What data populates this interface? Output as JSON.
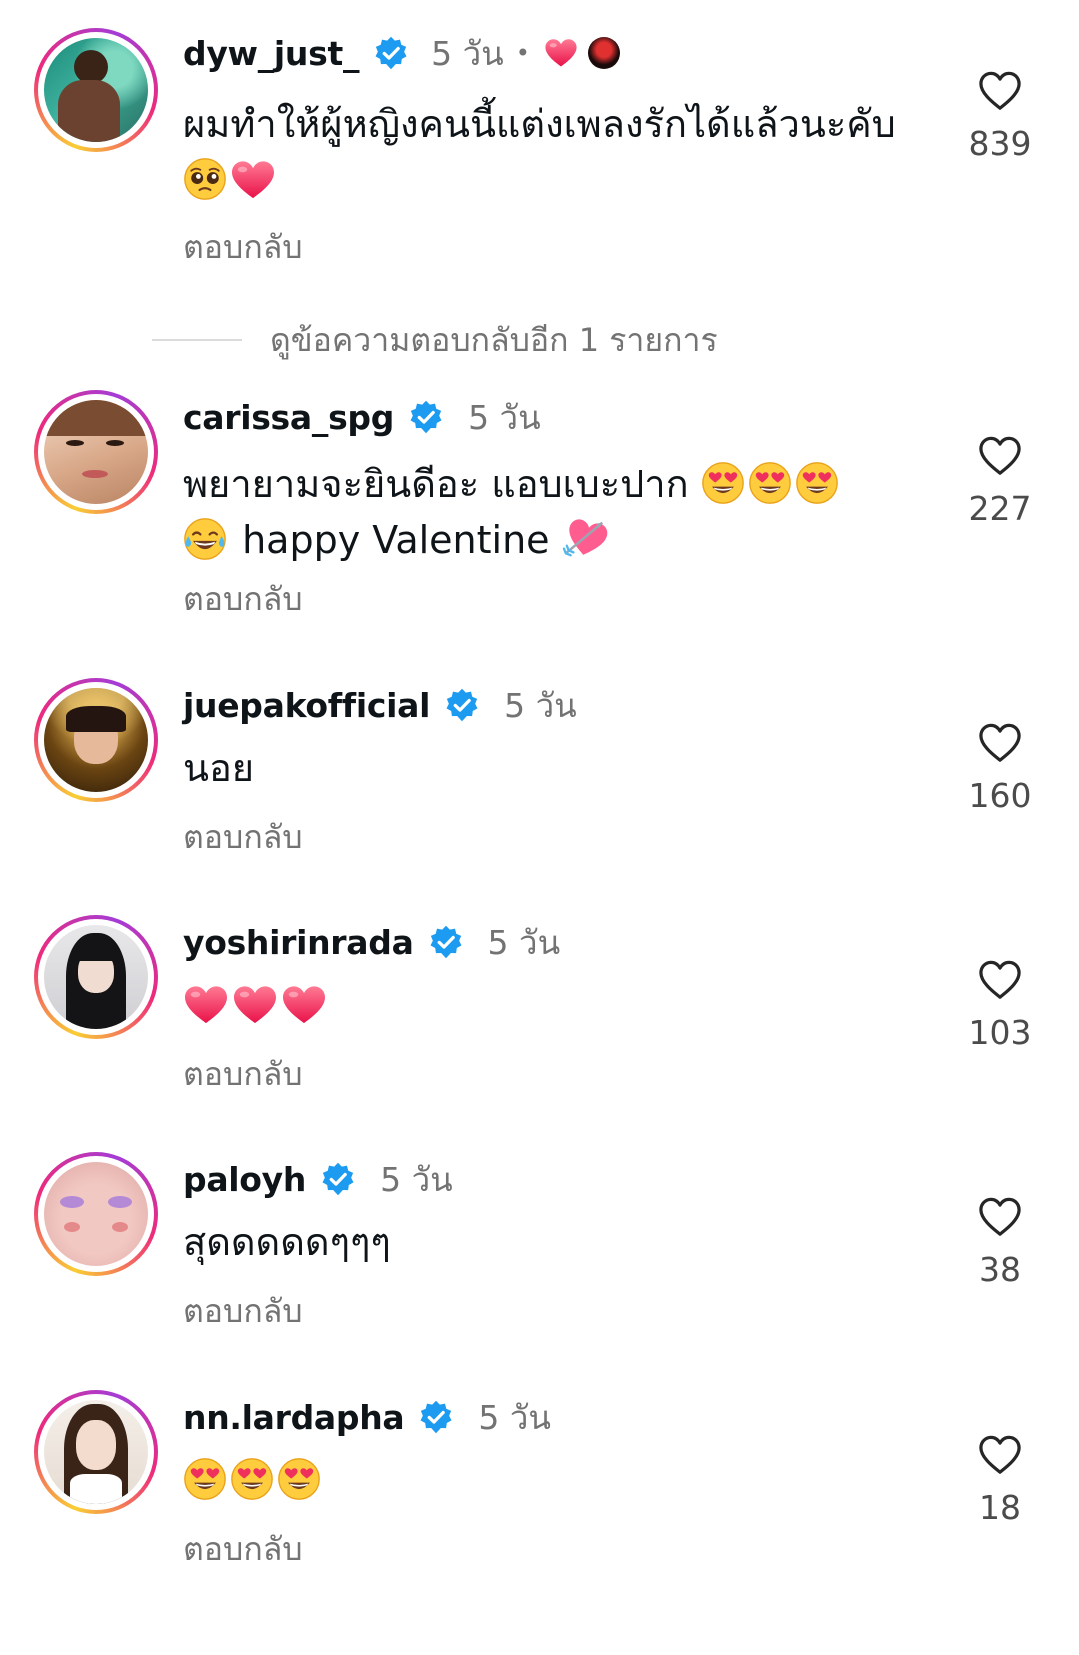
{
  "reply_label": "ตอบกลับ",
  "view_more_replies": "ดูข้อความตอบกลับอีก 1 รายการ",
  "colors": {
    "verified": "#1d9bf0",
    "muted_text": "#737373",
    "heart_emoji": "#f0305c"
  },
  "comments": [
    {
      "username": "dyw_just_",
      "verified": true,
      "timestamp": "5 วัน",
      "text": "ผมทำให้ผู้หญิงคนนี้แต่งเพลงรักได้แล้วนะคับ",
      "emojis": [
        "pleading-face",
        "red-heart"
      ],
      "author_reactions": [
        "red-heart",
        "liked-by-avatar"
      ],
      "likes": "839"
    },
    {
      "username": "carissa_spg",
      "verified": true,
      "timestamp": "5 วัน",
      "text": "พยายามจะยินดีอะ แอบเบะปาก",
      "emojis": [
        "heart-eyes",
        "heart-eyes",
        "heart-eyes"
      ],
      "text2": "happy Valentine",
      "emojis_lead2": [
        "tears-of-joy"
      ],
      "emojis_trail2": [
        "heart-with-arrow"
      ],
      "likes": "227"
    },
    {
      "username": "juepakofficial",
      "verified": true,
      "timestamp": "5 วัน",
      "text": "นอย",
      "likes": "160"
    },
    {
      "username": "yoshirinrada",
      "verified": true,
      "timestamp": "5 วัน",
      "text": "",
      "emojis": [
        "red-heart",
        "red-heart",
        "red-heart"
      ],
      "likes": "103"
    },
    {
      "username": "paloyh",
      "verified": true,
      "timestamp": "5 วัน",
      "text": "สุดดดดดๆๆๆ",
      "likes": "38"
    },
    {
      "username": "nn.lardapha",
      "verified": true,
      "timestamp": "5 วัน",
      "text": "",
      "emojis": [
        "heart-eyes",
        "heart-eyes",
        "heart-eyes"
      ],
      "likes": "18"
    }
  ]
}
